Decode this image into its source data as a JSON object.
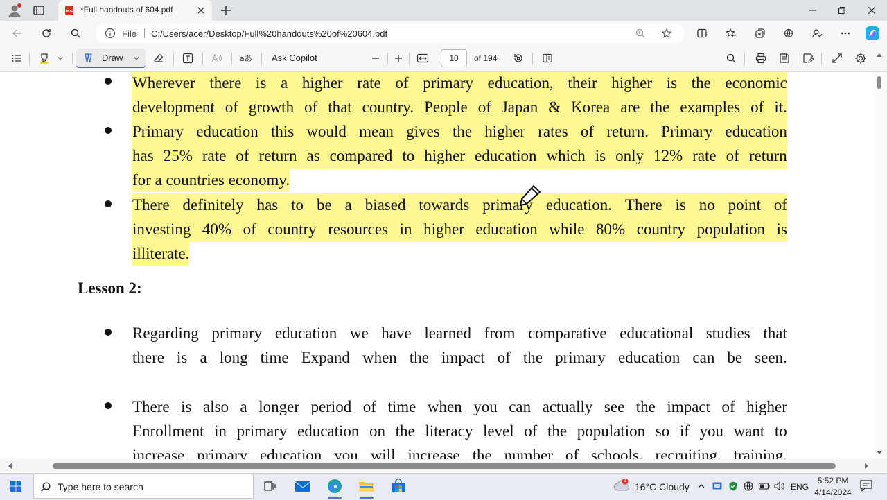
{
  "tab": {
    "title": "*Full handouts of 604.pdf"
  },
  "address": {
    "label": "File",
    "url": "C:/Users/acer/Desktop/Full%20handouts%20of%20604.pdf"
  },
  "toolbar": {
    "draw_label": "Draw",
    "ask_copilot": "Ask Copilot",
    "page_current": "10",
    "page_total": "of 194"
  },
  "document": {
    "paragraphs": [
      {
        "lines": [
          [
            "Wherever",
            "there",
            "is",
            "a",
            "higher",
            "rate",
            "of",
            "primary",
            "education,",
            "their",
            "higher",
            "is",
            "the",
            "economic"
          ],
          [
            "development",
            "of",
            "growth",
            "of",
            "that",
            "country.",
            "People",
            "of",
            "Japan",
            "&",
            "Korea",
            "are",
            "the",
            "examples",
            "of",
            "it."
          ]
        ]
      },
      {
        "lines": [
          [
            "Primary",
            "education",
            "this",
            "would",
            "mean",
            "gives",
            "the",
            "higher",
            "rates",
            "of",
            "return.",
            "Primary",
            "education"
          ],
          [
            "has",
            "25%",
            "rate",
            "of",
            "return",
            "as",
            "compared",
            "to",
            "higher",
            "education",
            "which",
            "is",
            "only",
            "12%",
            "rate",
            "of",
            "return"
          ],
          [
            "for",
            "a",
            "countries",
            "economy."
          ]
        ]
      },
      {
        "lines": [
          [
            "There",
            "definitely",
            "has",
            "to",
            "be",
            "a",
            "biased",
            "towards",
            "primary",
            "education.",
            "There",
            "is",
            "no",
            "point",
            "of"
          ],
          [
            "investing",
            "40%",
            "of",
            "country",
            "resources",
            "in",
            "higher",
            "education",
            "while",
            "80%",
            "country",
            "population",
            "is"
          ],
          [
            "illiterate."
          ]
        ]
      },
      {
        "lines": [
          [
            "Regarding",
            "primary",
            "education",
            "we",
            "have",
            "learned",
            "from",
            "comparative",
            "educational",
            "studies",
            "that"
          ],
          [
            "there",
            "is",
            "a",
            "long",
            "time",
            "Expand",
            "when",
            "the",
            "impact",
            "of",
            "the",
            "primary",
            "education",
            "can",
            "be",
            "seen."
          ]
        ]
      },
      {
        "lines": [
          [
            "There",
            "is",
            "also",
            "a",
            "longer",
            "period",
            "of",
            "time",
            "when",
            "you",
            "can",
            "actually",
            "see",
            "the",
            "impact",
            "of",
            "higher"
          ],
          [
            "Enrollment",
            "in",
            "primary",
            "education",
            "on",
            "the",
            "literacy",
            "level",
            "of",
            "the",
            "population",
            "so",
            "if",
            "you",
            "want",
            "to"
          ],
          [
            "increase",
            "primary",
            "education",
            "you",
            "will",
            "increase",
            "the",
            "number",
            "of",
            "schools,",
            "recruiting,",
            "training,"
          ]
        ]
      }
    ],
    "lesson_heading": "Lesson 2:"
  },
  "taskbar": {
    "search_placeholder": "Type here to search",
    "weather": "16°C  Cloudy",
    "weather_badge": "1",
    "language": "ENG",
    "time": "5:52 PM",
    "date": "4/14/2024"
  },
  "colors": {
    "highlight": "#fff791",
    "accent": "#2f6cd1"
  }
}
